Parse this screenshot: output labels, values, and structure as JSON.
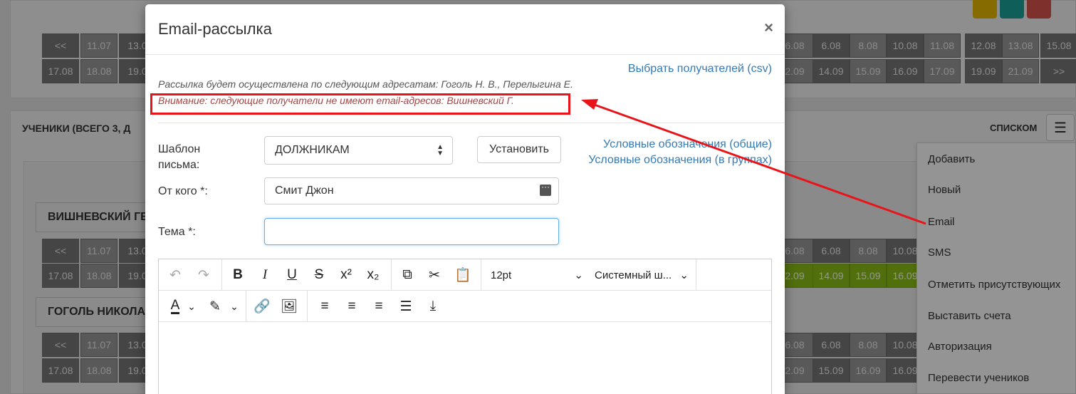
{
  "background": {
    "dates_row1": [
      "<<",
      "11.07",
      "13.0",
      "6.08",
      "6.08",
      "8.08",
      "10.08",
      "11.08",
      "12.08",
      "13.08",
      "15.08"
    ],
    "dates_row2": [
      "17.08",
      "18.08",
      "19.0",
      "2.09",
      "14.09",
      "15.09",
      "16.09",
      "17.09",
      "19.09",
      "21.09",
      ">>"
    ],
    "students_title": "УЧЕНИКИ (ВСЕГО 3, Д",
    "list_label": "СПИСКОМ",
    "group1": "ВИШНЕВСКИЙ ГЕ",
    "group2": "ГОГОЛЬ НИКОЛА",
    "g1_row1": [
      "<<",
      "11.07",
      "13.0",
      "6.08",
      "6.08",
      "8.08",
      "10.08"
    ],
    "g1_row2": [
      "17.08",
      "18.08",
      "19.0",
      "2.09",
      "14.09",
      "15.09",
      "16.09"
    ],
    "g2_row1": [
      "<<",
      "11.07",
      "13.0",
      "6.08",
      "6.08",
      "8.08",
      "10.08"
    ],
    "g2_row2": [
      "17.08",
      "18.08",
      "19.0",
      "2.09",
      "15.09",
      "16.09",
      "16.09"
    ]
  },
  "dropdown_menu": [
    "Добавить",
    "Новый",
    "Email",
    "SMS",
    "Отметить присутствующих",
    "Выставить счета",
    "Авторизация",
    "Перевести учеников"
  ],
  "modal": {
    "title": "Email-рассылка",
    "close": "×",
    "recipients_link_prefix": "Выбрать получателей (",
    "recipients_link_csv": "csv",
    "recipients_link_suffix": ")",
    "info": "Рассылка будет осуществлена по следующим адресатам: Гоголь Н. В., Перелыгина Е.",
    "warning": "Внимание: следующие получатели не имеют email-адресов: Вишневский Г.",
    "template_label": "Шаблон письма:",
    "template_value": "ДОЛЖНИКАМ",
    "set_button": "Установить",
    "legend_general": "Условные обозначения (общие)",
    "legend_groups": "Условные обозначения (в группах)",
    "from_label": "От кого *:",
    "from_value": "Смит Джон",
    "subject_label": "Тема *:",
    "subject_value": ""
  },
  "editor_toolbar": {
    "font_size": "12pt",
    "font_family": "Системный ш...",
    "bold": "B",
    "italic": "I",
    "underline": "U",
    "strike": "S",
    "text_color": "A"
  },
  "colors": {
    "accent_link": "#337ab7",
    "warning_text": "#a94442",
    "annotation": "#e8141a",
    "green_cell": "#8cbf17"
  }
}
